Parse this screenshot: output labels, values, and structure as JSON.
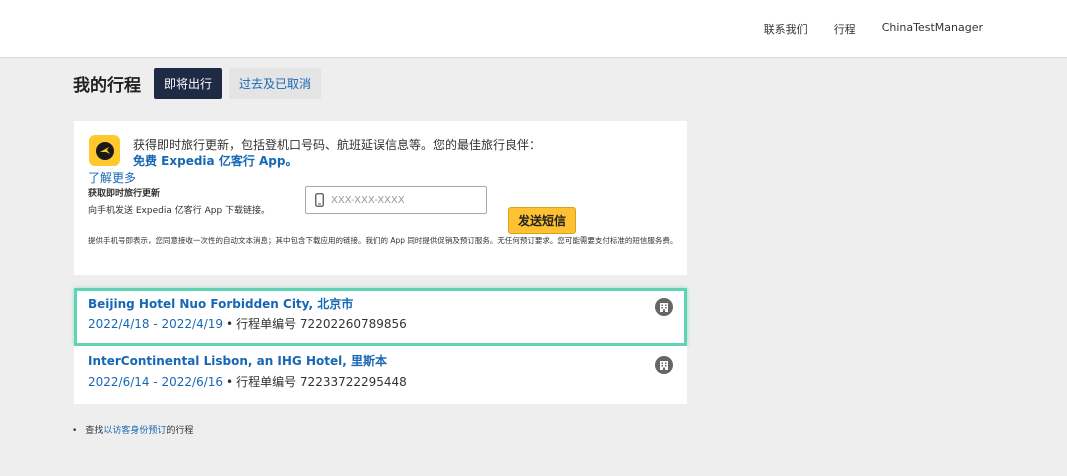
{
  "header": {
    "nav": [
      "联系我们",
      "行程",
      "ChinaTestManager"
    ]
  },
  "page": {
    "title": "我的行程",
    "tabs": [
      "即将出行",
      "过去及已取消"
    ]
  },
  "promo": {
    "icon": "expedia-app-icon",
    "text": "获得即时旅行更新，包括登机口号码、航班延误信息等。您的最佳旅行良伴：",
    "app_link": "免费 Expedia 亿客行 App。",
    "learn_more": "了解更多",
    "sms_label": "获取即时旅行更新",
    "sms_desc": "向手机发送 Expedia 亿客行 App 下载链接。",
    "phone_placeholder": "XXX-XXX-XXXX",
    "send_button": "发送短信",
    "disclaimer": "提供手机号即表示，您同意接收一次性的自动文本消息；其中包含下载应用的链接。我们的 App 同时提供促销及预订服务。无任何预订要求。您可能需要支付标准的短信服务费。"
  },
  "trips": [
    {
      "name": "Beijing Hotel Nuo Forbidden City, 北京市",
      "dates": "2022/4/18 - 2022/4/19",
      "itinerary": "行程单编号 72202260789856",
      "icon": "hotel-icon",
      "highlighted": true
    },
    {
      "name": "InterContinental Lisbon, an IHG Hotel, 里斯本",
      "dates": "2022/6/14 - 2022/6/16",
      "itinerary": "行程单编号 72233722295448",
      "icon": "hotel-icon",
      "highlighted": false
    }
  ],
  "footer": {
    "prefix": "查找",
    "link": "以访客身份预订",
    "suffix": "的行程"
  },
  "colors": {
    "accent_blue": "#1668b5",
    "tab_active": "#1f2a44",
    "send_button": "#fdc131",
    "highlight": "#5fd3b3"
  }
}
